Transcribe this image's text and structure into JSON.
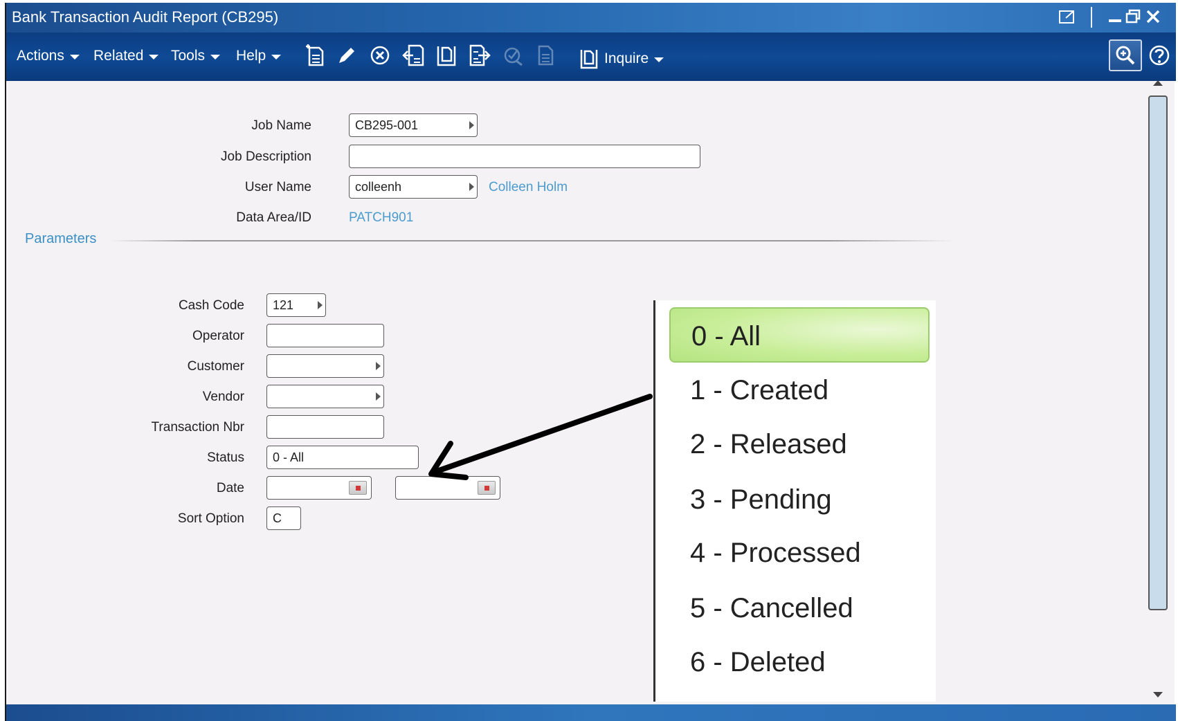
{
  "window": {
    "title": "Bank Transaction Audit Report (CB295)"
  },
  "toolbar": {
    "menus": [
      "Actions",
      "Related",
      "Tools",
      "Help"
    ],
    "inquire_label": "Inquire"
  },
  "form": {
    "job_name_label": "Job Name",
    "job_name_value": "CB295-001",
    "job_description_label": "Job Description",
    "job_description_value": "",
    "user_name_label": "User Name",
    "user_name_value": "colleenh",
    "user_full_name": "Colleen Holm",
    "data_area_label": "Data Area/ID",
    "data_area_value": "PATCH901"
  },
  "parameters": {
    "title": "Parameters",
    "cash_code_label": "Cash Code",
    "cash_code_value": "121",
    "operator_label": "Operator",
    "operator_value": "",
    "customer_label": "Customer",
    "customer_value": "",
    "vendor_label": "Vendor",
    "vendor_value": "",
    "transaction_nbr_label": "Transaction Nbr",
    "transaction_nbr_value": "",
    "status_label": "Status",
    "status_value": "0 - All",
    "date_label": "Date",
    "date_from_value": "",
    "date_to_value": "",
    "sort_option_label": "Sort Option",
    "sort_option_value": "C"
  },
  "status_options": [
    "0 - All",
    "1 - Created",
    "2 - Released",
    "3 - Pending",
    "4 - Processed",
    "5 - Cancelled",
    "6 - Deleted"
  ],
  "status_selected_index": 0,
  "colors": {
    "title_bar": "#2566ad",
    "toolbar": "#0f4a95",
    "link": "#4a9ccf",
    "selected_option": "#c9ee9a"
  }
}
